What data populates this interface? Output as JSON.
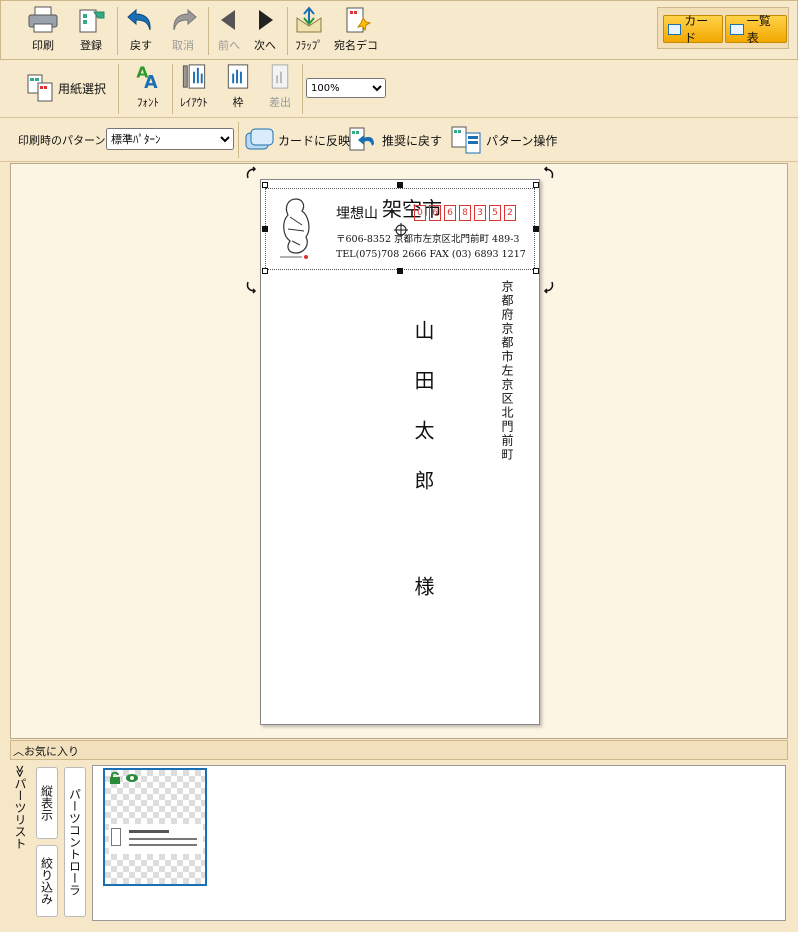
{
  "toolbar1": {
    "print": "印刷",
    "register": "登録",
    "undo": "戻す",
    "redo": "取消",
    "prev": "前へ",
    "next": "次へ",
    "flap": "ﾌﾗｯﾌﾟ",
    "address_deco": "宛名デコ",
    "card_view": "カード",
    "list_view": "一覧表"
  },
  "toolbar2": {
    "paper_select": "用紙選択",
    "font": "ﾌｫﾝﾄ",
    "layout": "ﾚｲｱｳﾄ",
    "frame": "枠",
    "sender": "差出",
    "zoom_value": "100%"
  },
  "toolbar3": {
    "pattern_label": "印刷時のパターン",
    "pattern_value": "標準ﾊﾟﾀｰﾝ",
    "apply_to_card": "カードに反映",
    "revert": "推奨に戻す",
    "pattern_ops": "パターン操作"
  },
  "card": {
    "sender_name": "埋想山",
    "sender_name_overlay": "架空市",
    "zip_digits": [
      "0",
      "6",
      "6",
      "8",
      "3",
      "5",
      "2"
    ],
    "sender_address": "〒606-8352 京都市左京区北門前町 489-3",
    "sender_phone": "TEL(075)708 2666 FAX (03) 6893 1217",
    "recipient_address": "京都府京都市左京区北門前町",
    "recipient_name": "山田太郎",
    "honorific": "様"
  },
  "favorites": {
    "label": "お気に入り"
  },
  "parts": {
    "list_label": "パーツリスト",
    "vertical_display": "縦表示",
    "filter": "絞り込み",
    "parts_controller": "パーツコントローラ"
  },
  "colors": {
    "accent": "#f3a800",
    "zip_red": "#d33333",
    "selection_blue": "#1b6fb3"
  }
}
